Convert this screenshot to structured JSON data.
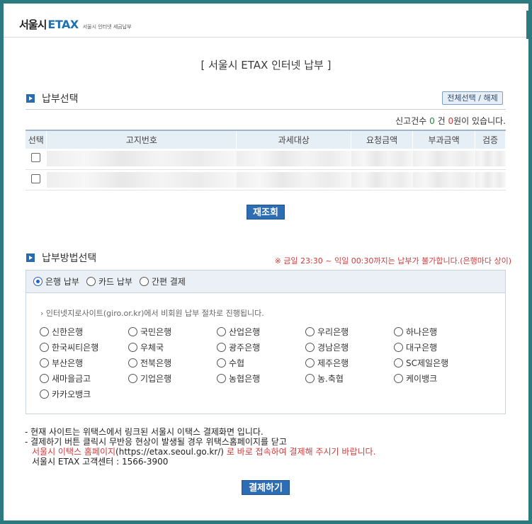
{
  "header": {
    "logo_city": "서울시",
    "logo_etax": "ETAX",
    "logo_sub": "서울시 인터넷 세금납부"
  },
  "page_title": "[ 서울시 ETAX 인터넷 납부 ]",
  "selection": {
    "section_label": "납부선택",
    "toggle_button": "전체선택 / 해제",
    "count_prefix": "신고건수",
    "count_value": "0",
    "count_unit": "건",
    "amount_value": "0",
    "amount_suffix": "원이 있습니다.",
    "columns": [
      "선택",
      "고지번호",
      "과세대상",
      "요청금액",
      "부과금액",
      "검증"
    ],
    "rows": [
      {
        "checked": false
      },
      {
        "checked": false
      }
    ],
    "refresh_button": "재조회"
  },
  "method": {
    "section_label": "납부방법선택",
    "warning": "※ 금일 23:30 ~ 익일 00:30까지는 납부가 불가합니다.(은행마다 상이)",
    "tabs": [
      {
        "label": "은행 납부",
        "selected": true
      },
      {
        "label": "카드 납부",
        "selected": false
      },
      {
        "label": "간편 결제",
        "selected": false
      }
    ],
    "notice": "인터넷지로사이트(giro.or.kr)에서 비회원 납부 절차로 진행됩니다.",
    "banks": [
      "신한은행",
      "국민은행",
      "산업은행",
      "우리은행",
      "하나은행",
      "한국씨티은행",
      "우체국",
      "광주은행",
      "경남은행",
      "대구은행",
      "부산은행",
      "전북은행",
      "수협",
      "제주은행",
      "SC제일은행",
      "새마을금고",
      "기업은행",
      "농협은행",
      "농.축협",
      "케이뱅크",
      "카카오뱅크"
    ]
  },
  "footer": {
    "line1": "- 현재 사이트는 위택스에서 링크된 서울시 이택스 결제화면 입니다.",
    "line2": "- 결제하기 버튼 클릭시 무반응 현상이 발생될 경우 위택스홈페이지를 닫고",
    "line3_red_a": "서울시 이택스 홈페이지",
    "line3_url": "(https://etax.seoul.go.kr/)",
    "line3_red_b": "로 바로 접속하여 결제해 주시기 바랍니다.",
    "line4": "서울시 ETAX 고객센터 : 1566-3900",
    "pay_button": "결제하기"
  },
  "colors": {
    "border": "#2a7a80",
    "accent": "#2c6db4",
    "warning": "#d43a3a"
  }
}
